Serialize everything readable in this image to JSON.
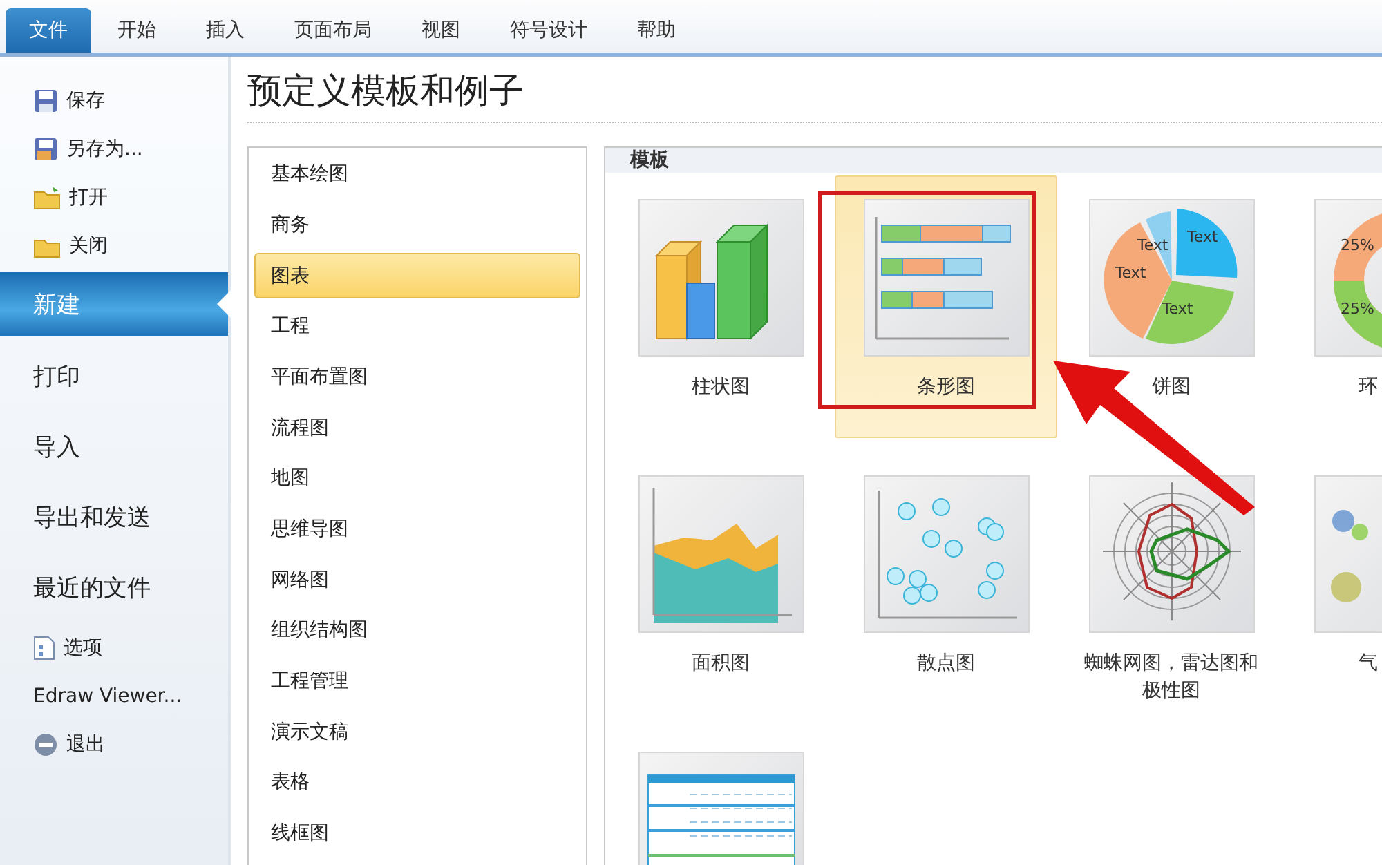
{
  "ribbon_tabs": [
    {
      "label": "文件",
      "selected": true
    },
    {
      "label": "开始",
      "selected": false
    },
    {
      "label": "插入",
      "selected": false
    },
    {
      "label": "页面布局",
      "selected": false
    },
    {
      "label": "视图",
      "selected": false
    },
    {
      "label": "符号设计",
      "selected": false
    },
    {
      "label": "帮助",
      "selected": false
    }
  ],
  "sidebar": {
    "items": [
      {
        "label": "保存",
        "kind": "icon",
        "selected": false
      },
      {
        "label": "另存为...",
        "kind": "icon",
        "selected": false
      },
      {
        "label": "打开",
        "kind": "icon",
        "selected": false
      },
      {
        "label": "关闭",
        "kind": "icon",
        "selected": false
      },
      {
        "label": "新建",
        "kind": "large",
        "selected": true
      },
      {
        "label": "打印",
        "kind": "large",
        "selected": false
      },
      {
        "label": "导入",
        "kind": "large",
        "selected": false
      },
      {
        "label": "导出和发送",
        "kind": "large",
        "selected": false
      },
      {
        "label": "最近的文件",
        "kind": "large",
        "selected": false
      },
      {
        "label": "选项",
        "kind": "icon",
        "selected": false
      },
      {
        "label": "Edraw Viewer...",
        "kind": "plain",
        "selected": false
      },
      {
        "label": "退出",
        "kind": "icon",
        "selected": false
      }
    ]
  },
  "page_title": "预定义模板和例子",
  "categories": [
    {
      "label": "基本绘图",
      "selected": false
    },
    {
      "label": "商务",
      "selected": false
    },
    {
      "label": "图表",
      "selected": true
    },
    {
      "label": "工程",
      "selected": false
    },
    {
      "label": "平面布置图",
      "selected": false
    },
    {
      "label": "流程图",
      "selected": false
    },
    {
      "label": "地图",
      "selected": false
    },
    {
      "label": "思维导图",
      "selected": false
    },
    {
      "label": "网络图",
      "selected": false
    },
    {
      "label": "组织结构图",
      "selected": false
    },
    {
      "label": "工程管理",
      "selected": false
    },
    {
      "label": "演示文稿",
      "selected": false
    },
    {
      "label": "表格",
      "selected": false
    },
    {
      "label": "线框图",
      "selected": false
    }
  ],
  "templates": {
    "header": "模板",
    "items": [
      {
        "kind": "bar3d",
        "label": "柱状图",
        "selected": false
      },
      {
        "kind": "barh",
        "label": "条形图",
        "selected": true
      },
      {
        "kind": "pie",
        "label": "饼图",
        "selected": false,
        "thumb_labels": [
          "Text",
          "Text",
          "Text",
          "Text"
        ]
      },
      {
        "kind": "donut",
        "label": "环",
        "selected": false,
        "thumb_labels": [
          "25%",
          "25%"
        ]
      },
      {
        "kind": "area",
        "label": "面积图",
        "selected": false
      },
      {
        "kind": "scatter",
        "label": "散点图",
        "selected": false
      },
      {
        "kind": "radar",
        "label": "蜘蛛网图，雷达图和极性图",
        "selected": false
      },
      {
        "kind": "bubble",
        "label": "气",
        "selected": false
      },
      {
        "kind": "table",
        "selected": false
      }
    ]
  }
}
